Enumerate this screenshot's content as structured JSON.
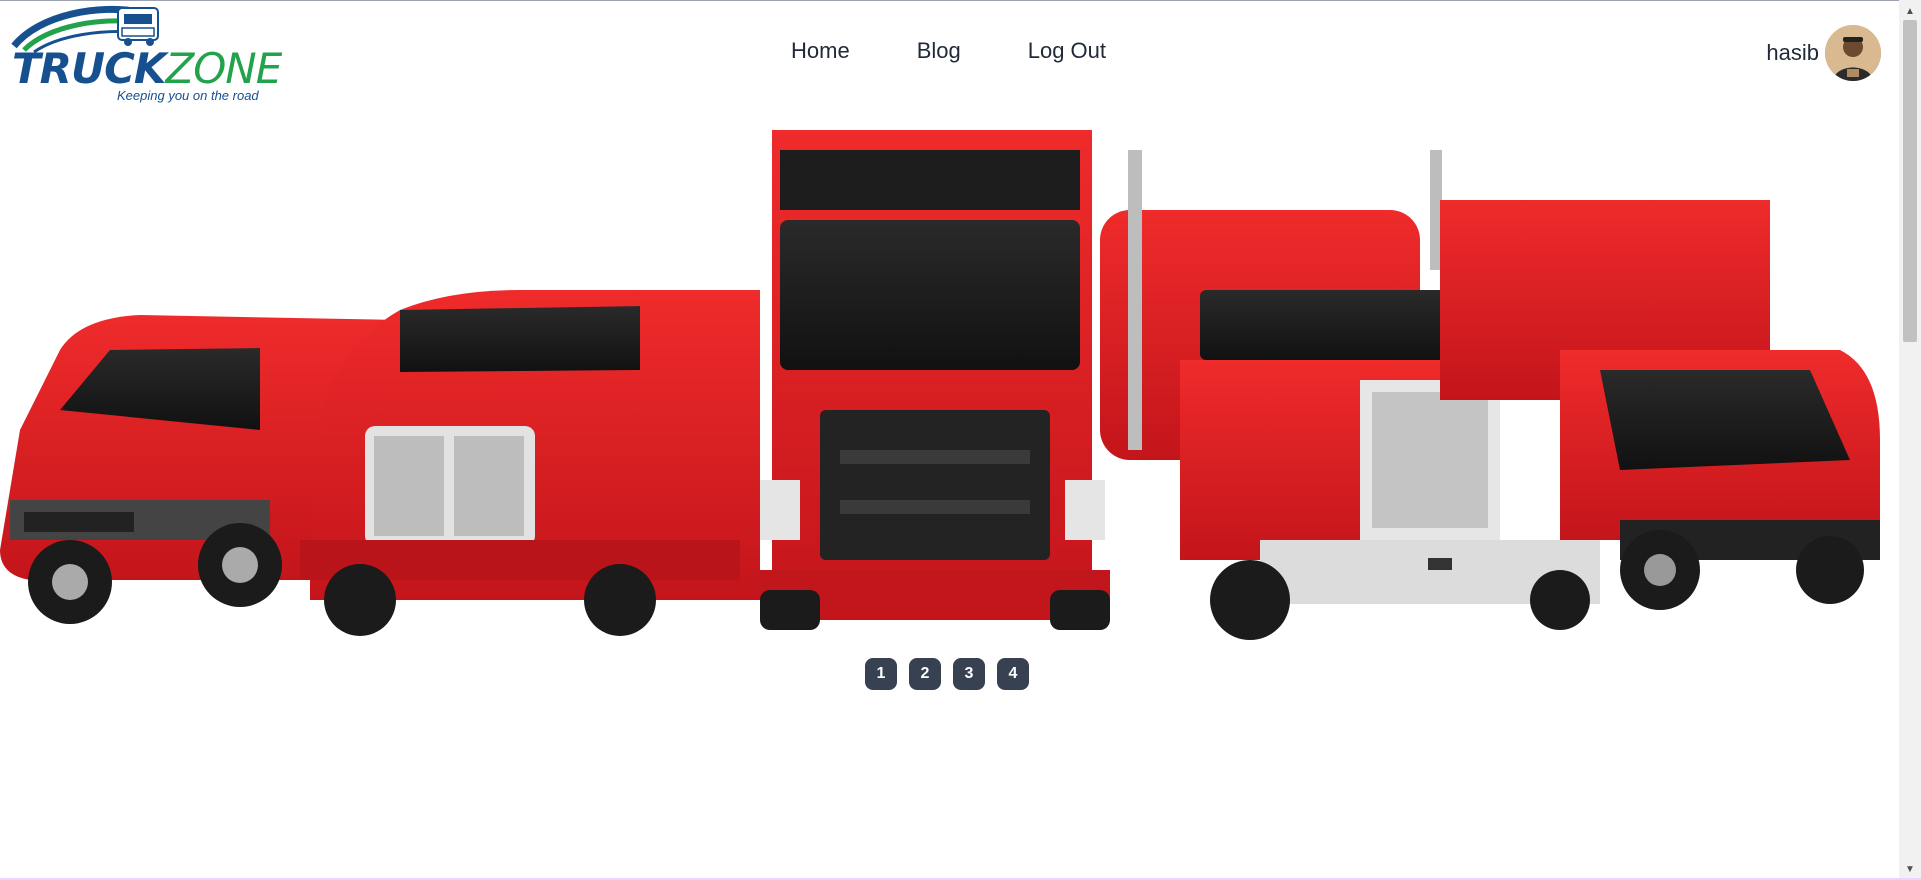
{
  "brand": {
    "name_part1": "TRUCK",
    "name_part2": "ZONE",
    "tagline": "Keeping you on the road"
  },
  "nav": {
    "items": [
      {
        "label": "Home"
      },
      {
        "label": "Blog"
      },
      {
        "label": "Log Out"
      }
    ]
  },
  "user": {
    "name": "hasib"
  },
  "hero": {
    "subject": "row of red trucks"
  },
  "pager": {
    "pages": [
      "1",
      "2",
      "3",
      "4"
    ]
  },
  "colors": {
    "brand_blue": "#16508f",
    "brand_green": "#22a24a",
    "truck_red": "#d6111b",
    "pager_bg": "#374151"
  }
}
